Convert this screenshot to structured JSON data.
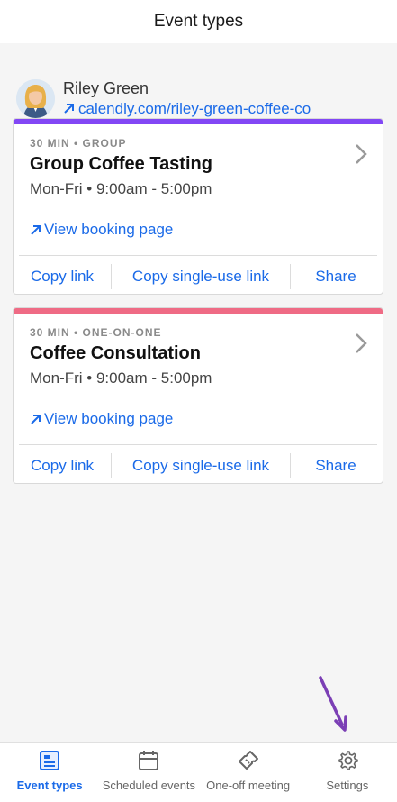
{
  "header": {
    "title": "Event types"
  },
  "profile": {
    "name": "Riley Green",
    "link": "calendly.com/riley-green-coffee-co"
  },
  "cards": [
    {
      "accent_color": "#8247f5",
      "meta": "30 MIN • GROUP",
      "title": "Group Coffee Tasting",
      "schedule": "Mon-Fri • 9:00am - 5:00pm",
      "view_label": "View booking page",
      "actions": {
        "copy": "Copy link",
        "single": "Copy single-use link",
        "share": "Share"
      }
    },
    {
      "accent_color": "#ef6b85",
      "meta": "30 MIN • ONE-ON-ONE",
      "title": "Coffee Consultation",
      "schedule": "Mon-Fri • 9:00am - 5:00pm",
      "view_label": "View booking page",
      "actions": {
        "copy": "Copy link",
        "single": "Copy single-use link",
        "share": "Share"
      }
    }
  ],
  "tabs": [
    {
      "label": "Event types",
      "icon": "event-types-icon",
      "active": true
    },
    {
      "label": "Scheduled events",
      "icon": "calendar-icon",
      "active": false
    },
    {
      "label": "One-off meeting",
      "icon": "ticket-icon",
      "active": false
    },
    {
      "label": "Settings",
      "icon": "gear-icon",
      "active": false
    }
  ],
  "colors": {
    "link": "#1a6ae8",
    "active_tab": "#1a6ae8",
    "annotation_arrow": "#7b3fb5"
  }
}
